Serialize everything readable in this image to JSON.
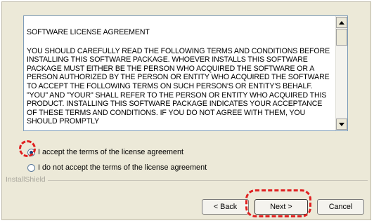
{
  "license": {
    "title": "SOFTWARE LICENSE AGREEMENT",
    "body": "YOU SHOULD CAREFULLY READ THE FOLLOWING TERMS AND CONDITIONS BEFORE INSTALLING THIS SOFTWARE PACKAGE. WHOEVER INSTALLS THIS SOFTWARE PACKAGE MUST EITHER BE THE PERSON WHO ACQUIRED THE SOFTWARE OR A PERSON AUTHORIZED BY THE PERSON OR ENTITY WHO ACQUIRED THE SOFTWARE TO ACCEPT THE FOLLOWING TERMS ON SUCH PERSON'S OR ENTITY'S BEHALF. \"YOU\" AND \"YOUR\" SHALL REFER TO THE PERSON OR ENTITY WHO ACQUIRED THIS PRODUCT. INSTALLING THIS SOFTWARE PACKAGE INDICATES YOUR ACCEPTANCE OF THESE TERMS AND CONDITIONS. IF YOU DO NOT AGREE WITH THEM, YOU SHOULD PROMPTLY"
  },
  "options": {
    "accept_label": "I accept the terms of the license agreement",
    "decline_label": "I do not accept the terms of the license agreement",
    "selected": "accept"
  },
  "group_label": "InstallShield",
  "buttons": {
    "back": "< Back",
    "next": "Next >",
    "cancel": "Cancel"
  },
  "colors": {
    "annotation": "#e02020",
    "dialog_bg": "#ece9d8"
  }
}
